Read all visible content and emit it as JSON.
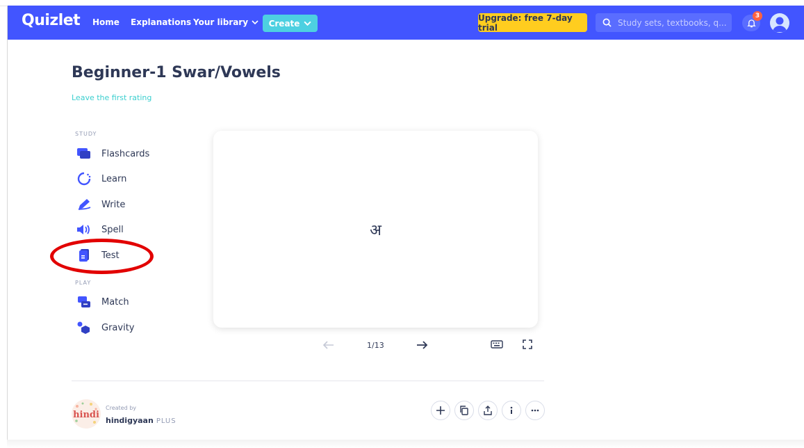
{
  "nav": {
    "logo": "Quizlet",
    "home": "Home",
    "explanations": "Explanations",
    "library": "Your library",
    "create": "Create",
    "upgrade": "Upgrade: free 7-day trial",
    "search_placeholder": "Study sets, textbooks, q...",
    "notification_count": "3"
  },
  "set": {
    "title": "Beginner-1 Swar/Vowels",
    "rating_link": "Leave the first rating"
  },
  "study": {
    "section_label": "STUDY",
    "modes": [
      "Flashcards",
      "Learn",
      "Write",
      "Spell",
      "Test"
    ]
  },
  "play": {
    "section_label": "PLAY",
    "modes": [
      "Match",
      "Gravity"
    ]
  },
  "flashcard": {
    "term": "अ",
    "counter": "1/13"
  },
  "creator": {
    "created_by": "Created by",
    "name": "hindigyaan",
    "badge": "PLUS",
    "avatar_text": "hindi"
  },
  "colors": {
    "brand": "#4255ff",
    "create": "#4dd0e1",
    "upgrade": "#ffcd1f",
    "highlight": "#e20000"
  }
}
